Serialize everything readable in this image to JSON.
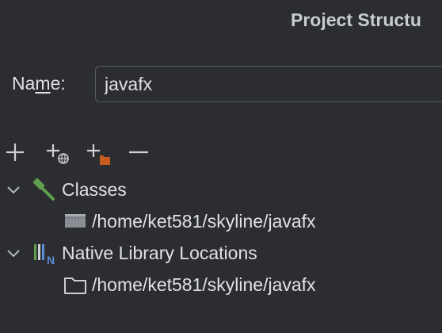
{
  "window": {
    "title": "Project Structu"
  },
  "name_field": {
    "label_prefix": "Na",
    "label_mnemonic": "m",
    "label_suffix": "e:",
    "value": "javafx"
  },
  "toolbar": {
    "buttons": [
      {
        "icon": "plus-icon"
      },
      {
        "icon": "add-web-icon"
      },
      {
        "icon": "add-folder-icon"
      },
      {
        "icon": "minus-icon"
      }
    ]
  },
  "tree": {
    "classes": {
      "label": "Classes",
      "icon": "hammer-icon",
      "children": [
        {
          "label": "/home/ket581/skyline/javafx",
          "icon": "jar-icon"
        }
      ]
    },
    "native": {
      "label": "Native Library Locations",
      "icon": "native-library-icon",
      "children": [
        {
          "label": "/home/ket581/skyline/javafx",
          "icon": "folder-icon"
        }
      ]
    }
  },
  "colors": {
    "background": "#2b2d30",
    "text": "#dfe1e5",
    "accent_green": "#5fa04e",
    "accent_orange": "#c75a1f",
    "accent_blue": "#5c8fd6"
  }
}
